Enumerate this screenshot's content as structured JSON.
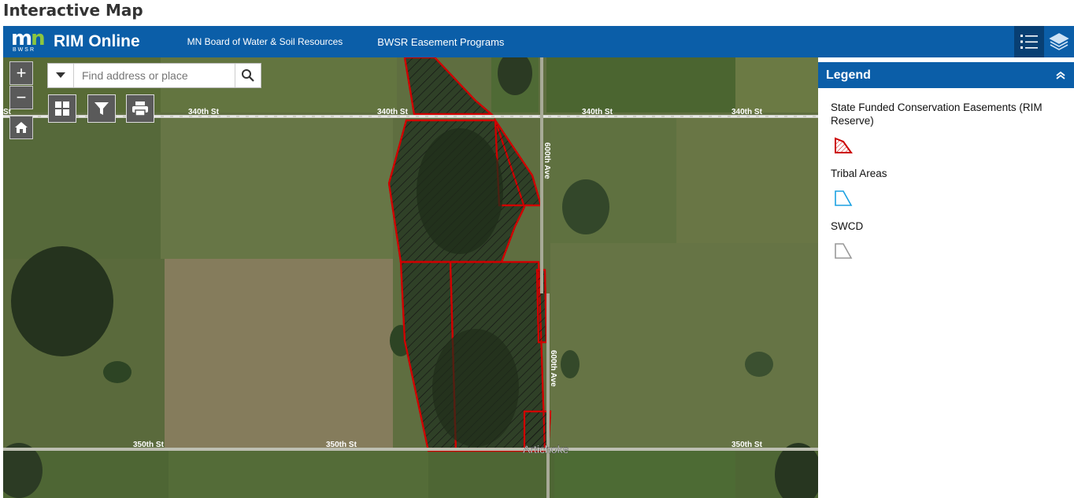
{
  "page_title": "Interactive Map",
  "header": {
    "app_title": "RIM Online",
    "logo_text": "BWSR",
    "links": [
      "MN Board of Water & Soil Resources",
      "BWSR Easement Programs"
    ],
    "buttons": [
      "list-icon",
      "layers-icon"
    ]
  },
  "map": {
    "zoom_in_label": "+",
    "zoom_out_label": "−",
    "search": {
      "placeholder": "Find address or place",
      "value": ""
    },
    "tools": [
      "basemap-gallery-icon",
      "filter-icon",
      "print-icon"
    ],
    "road_labels": {
      "r340_left": "340th St",
      "r340_mid": "340th St",
      "r340_right": "340th St",
      "r340_far": "340th St",
      "r340_edge": "St",
      "r350_left": "350th St",
      "r350_mid": "350th St",
      "r350_right": "350th St",
      "ave600_top": "600th Ave",
      "ave600_bottom": "600th Ave"
    },
    "place_label": "Artichoke",
    "colors": {
      "easement_outline": "#d00000",
      "tribal": "#1ba1e2",
      "swcd": "#999999"
    }
  },
  "legend": {
    "title": "Legend",
    "layers": [
      {
        "label": "State Funded Conservation Easements (RIM Reserve)"
      },
      {
        "label": "Tribal Areas"
      },
      {
        "label": "SWCD"
      }
    ]
  }
}
